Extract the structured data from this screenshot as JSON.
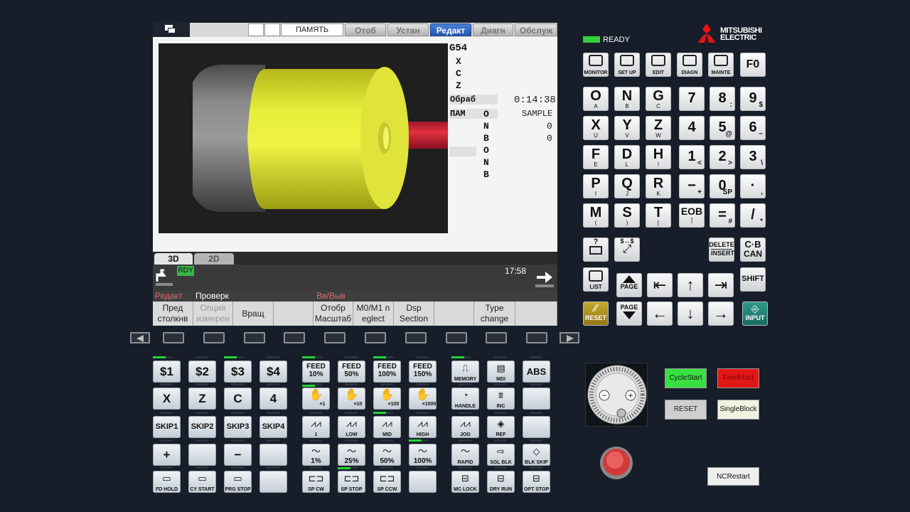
{
  "topbar": {
    "mode_field": "ПАМЯТЬ",
    "tabs": [
      {
        "label": "Отоб",
        "active": false
      },
      {
        "label": "Устан",
        "active": false
      },
      {
        "label": "Редакт",
        "active": true
      },
      {
        "label": "Диагн",
        "active": false
      },
      {
        "label": "Обслуж",
        "active": false
      }
    ]
  },
  "info": {
    "gcode": "G54",
    "axes": [
      "X",
      "C",
      "Z"
    ],
    "time_label": "Обраб",
    "time_value": "0:14:38",
    "prog_label": "ПАМ",
    "prog_name": "SAMPLE",
    "onb1": [
      "O",
      "N",
      "B"
    ],
    "onb1_vals": [
      "0",
      "0"
    ],
    "onb2": [
      "O",
      "N",
      "B"
    ]
  },
  "view_tabs": {
    "tab1": "3D",
    "tab2": "2D"
  },
  "status": {
    "rdy": "RDY",
    "clock": "17:58"
  },
  "menu_hdr": {
    "left1": "Редакт",
    "left2": "Проверк",
    "center": "Вв/Выв"
  },
  "softkeys": [
    {
      "l1": "Пред",
      "l2": "столкнв",
      "dim": false
    },
    {
      "l1": "Опция",
      "l2": "измерен",
      "dim": true
    },
    {
      "l1": "Вращ",
      "l2": "",
      "dim": false
    },
    {
      "l1": "",
      "l2": "",
      "dim": false
    },
    {
      "l1": "Отобр",
      "l2": "Масштаб",
      "dim": false
    },
    {
      "l1": "M0/M1 n",
      "l2": "eglect",
      "dim": false
    },
    {
      "l1": "Dsp",
      "l2": "Section",
      "dim": false
    },
    {
      "l1": "",
      "l2": "",
      "dim": false
    },
    {
      "l1": "Type",
      "l2": "change",
      "dim": false
    },
    {
      "l1": "",
      "l2": "",
      "dim": false
    }
  ],
  "right": {
    "ready": "READY",
    "brand1": "MITSUBISHI",
    "brand2": "ELECTRIC",
    "fkeys": [
      "MONITOR",
      "SET UP",
      "EDIT",
      "DIAGN",
      "MAINTE"
    ],
    "f0": "F0",
    "letters": [
      [
        "O",
        "A"
      ],
      [
        "N",
        "B"
      ],
      [
        "G",
        "C"
      ],
      [
        "X",
        "U"
      ],
      [
        "Y",
        "V"
      ],
      [
        "Z",
        "W"
      ],
      [
        "F",
        "E"
      ],
      [
        "D",
        "L"
      ],
      [
        "H",
        "!"
      ],
      [
        "P",
        "I"
      ],
      [
        "Q",
        "J"
      ],
      [
        "R",
        "K"
      ],
      [
        "M",
        "("
      ],
      [
        "S",
        ")"
      ],
      [
        "T",
        "["
      ]
    ],
    "nums": [
      [
        "7",
        ""
      ],
      [
        "8",
        ":"
      ],
      [
        "9",
        "$"
      ],
      [
        "4",
        ""
      ],
      [
        "5",
        "@"
      ],
      [
        "6",
        "~"
      ],
      [
        "1",
        "<"
      ],
      [
        "2",
        ">"
      ],
      [
        "3",
        "\\"
      ],
      [
        "−",
        "+"
      ],
      [
        "0",
        "SP"
      ],
      [
        "·",
        ","
      ],
      [
        "EOB",
        "]"
      ],
      [
        "=",
        "#"
      ],
      [
        "/",
        "*"
      ]
    ],
    "delete1": "DELETE",
    "delete2": "INSERT",
    "cb1": "C·B",
    "cb2": "CAN",
    "list": "LIST",
    "page": "PAGE",
    "shift": "SHIFT",
    "reset": "RESET",
    "input": "INPUT"
  },
  "operator": {
    "row1": [
      "$1",
      "$2",
      "$3",
      "$4"
    ],
    "feed": [
      [
        "FEED",
        "10%"
      ],
      [
        "FEED",
        "50%"
      ],
      [
        "FEED",
        "100%"
      ],
      [
        "FEED",
        "150%"
      ]
    ],
    "row1b": [
      "MEMORY",
      "MDI",
      "ABS"
    ],
    "row2": [
      "X",
      "Z",
      "C",
      "4"
    ],
    "hand": [
      "×1",
      "×10",
      "×100",
      "×1000"
    ],
    "row2b": [
      "HANDLE",
      "INC"
    ],
    "row3": [
      "SKIP1",
      "SKIP2",
      "SKIP3",
      "SKIP4"
    ],
    "jog": [
      "1",
      "LOW",
      "MID",
      "HIGH"
    ],
    "row3b": [
      "JOG",
      "REF"
    ],
    "row4": [
      "+",
      "",
      "−",
      ""
    ],
    "rapid": [
      "1%",
      "25%",
      "50%",
      "100%"
    ],
    "row4b": [
      "RAPID",
      "SGL BLK",
      "BLK SKIP"
    ],
    "row5": [
      "FD HOLD",
      "CY START",
      "PRG STOP",
      ""
    ],
    "sp": [
      "SP CW",
      "SP STOP",
      "SP CCW",
      ""
    ],
    "row5b": [
      "MC LOCK",
      "DRY RUN",
      "OPT STOP"
    ]
  },
  "panel": {
    "cycle_start": "CycleStart",
    "feed_hold": "FeedHold",
    "reset": "RESET",
    "single_block": "SingleBlock",
    "nc_restart": "NCRestart"
  }
}
